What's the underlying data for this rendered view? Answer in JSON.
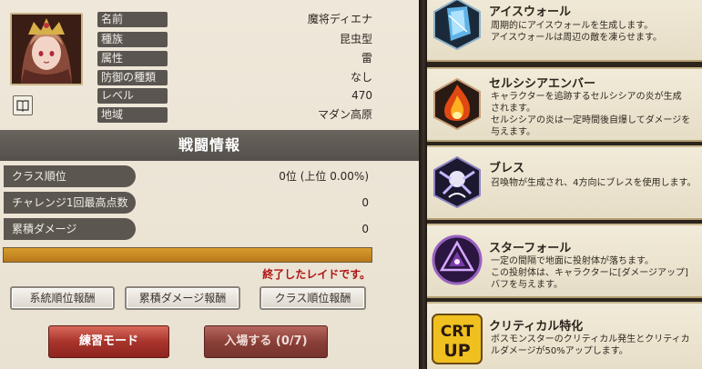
{
  "character": {
    "portrait_icon": "character-portrait",
    "book_icon": "book-icon",
    "info": [
      {
        "label": "名前",
        "value": "魔将ディエナ"
      },
      {
        "label": "種族",
        "value": "昆虫型"
      },
      {
        "label": "属性",
        "value": "雷"
      },
      {
        "label": "防御の種類",
        "value": "なし"
      },
      {
        "label": "レベル",
        "value": "470"
      },
      {
        "label": "地域",
        "value": "マダン高原"
      }
    ]
  },
  "battle": {
    "header": "戦闘情報",
    "stats": [
      {
        "label": "クラス順位",
        "value": "0位 (上位 0.00%)"
      },
      {
        "label": "チャレンジ1回最高点数",
        "value": "0"
      },
      {
        "label": "累積ダメージ",
        "value": "0"
      }
    ],
    "progress_fraction": 1.0,
    "status_message": "終了したレイドです。"
  },
  "buttons": {
    "reward_1": "系統順位報酬",
    "reward_2": "累積ダメージ報酬",
    "reward_3": "クラス順位報酬",
    "practice": "練習モード",
    "enter": "入場する (0/7)"
  },
  "skills": [
    {
      "name": "アイスウォール",
      "icon": "ice-wall-icon",
      "desc": [
        "周期的にアイスウォールを生成します。",
        "アイスウォールは周辺の敵を凍らせます。"
      ]
    },
    {
      "name": "セルシシアエンバー",
      "icon": "fire-ember-icon",
      "desc": [
        "キャラクターを追跡するセルシシアの炎が生成",
        "されます。",
        "セルシシアの炎は一定時間後自爆してダメージを",
        "与えます。"
      ]
    },
    {
      "name": "ブレス",
      "icon": "breath-icon",
      "desc": [
        "召喚物が生成され、4方向にブレスを使用します。"
      ]
    },
    {
      "name": "スターフォール",
      "icon": "star-fall-icon",
      "desc": [
        "一定の間隔で地面に投射体が落ちます。",
        "この投射体は、キャラクターに[ダメージアップ]",
        "バフを与えます。"
      ]
    },
    {
      "name": "クリティカル特化",
      "icon": "crt-up-icon",
      "desc": [
        "ボスモンスターのクリティカル発生とクリティカ",
        "ルダメージが50%アップします。"
      ]
    }
  ],
  "colors": {
    "status_red": "#b01414",
    "progress_orange": "#d89c2c",
    "practice_red": "#a8342c"
  }
}
